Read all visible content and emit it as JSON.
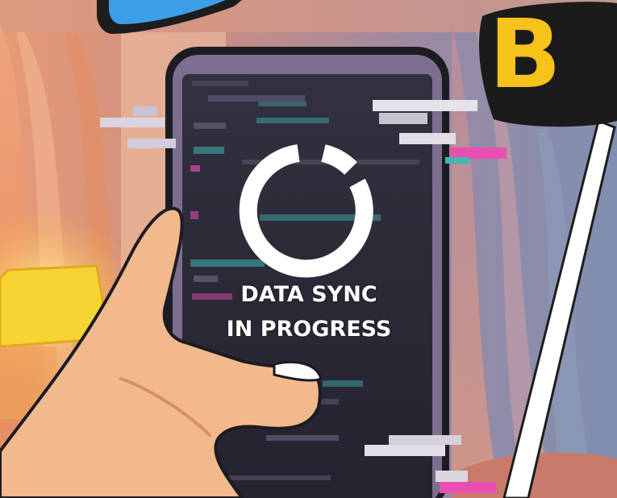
{
  "phone_screen": {
    "status_line1": "DATA SYNC",
    "status_line2": "IN PROGRESS",
    "icon": "sync-loading-ring-icon"
  },
  "logo": {
    "partial_text": "B"
  },
  "colors": {
    "logo_yellow": "#f7c219",
    "screen_dark": "#2a2738",
    "glitch_pink": "#e94fb0",
    "glitch_teal": "#3fb7b0",
    "lamp_yellow": "#f6d433",
    "skin": "#f2b98c"
  }
}
